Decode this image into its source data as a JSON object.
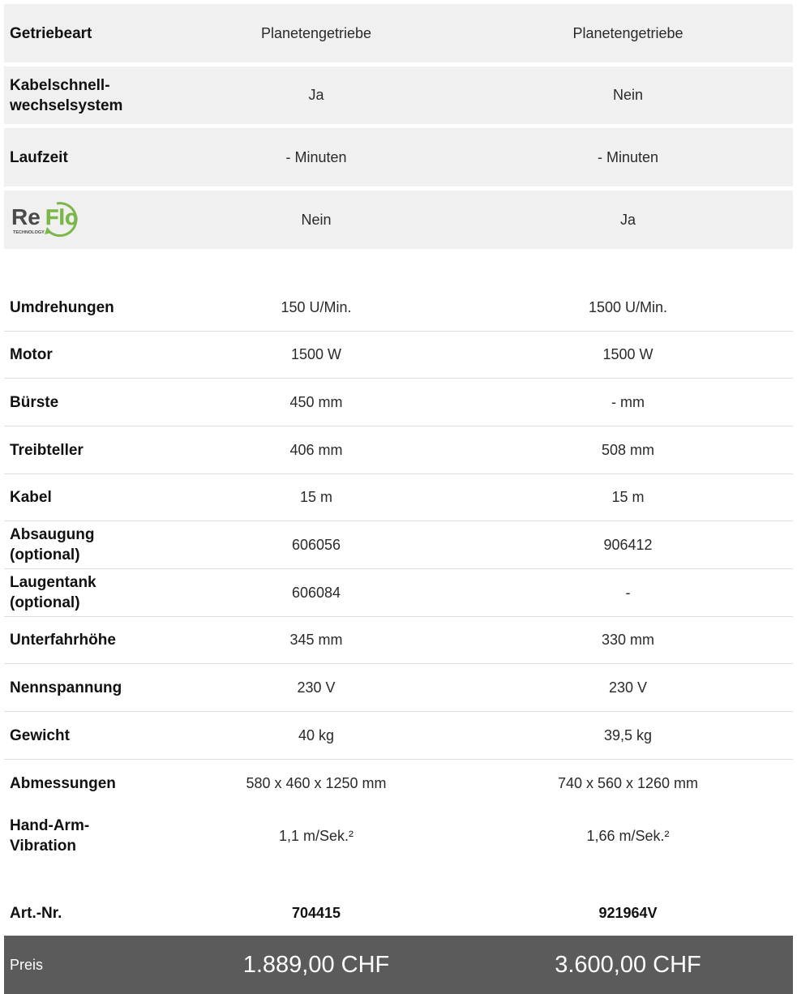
{
  "features": [
    {
      "label": "Getriebeart",
      "col1": "Planetengetriebe",
      "col2": "Planetengetriebe"
    },
    {
      "label": "Kabelschnell-\nwechselsystem",
      "col1": "Ja",
      "col2": "Nein"
    },
    {
      "label": "Laufzeit",
      "col1": "- Minuten",
      "col2": "- Minuten"
    }
  ],
  "reflo": {
    "logo_text_re": "Re",
    "logo_text_flo": "Flo",
    "logo_sub": "TECHNOLOGY",
    "col1": "Nein",
    "col2": "Ja",
    "colors": {
      "dark": "#4a4a4a",
      "green": "#7ab648"
    }
  },
  "specs": [
    {
      "label": "Umdrehungen",
      "col1": "150 U/Min.",
      "col2": "1500 U/Min."
    },
    {
      "label": "Motor",
      "col1": "1500 W",
      "col2": "1500 W"
    },
    {
      "label": "Bürste",
      "col1": "450 mm",
      "col2": "- mm"
    },
    {
      "label": "Treibteller",
      "col1": "406 mm",
      "col2": "508 mm"
    },
    {
      "label": "Kabel",
      "col1": "15 m",
      "col2": "15 m"
    },
    {
      "label": "Absaugung\n(optional)",
      "col1": "606056",
      "col2": "906412"
    },
    {
      "label": "Laugentank\n(optional)",
      "col1": "606084",
      "col2": "-"
    },
    {
      "label": "Unterfahrhöhe",
      "col1": "345 mm",
      "col2": "330 mm"
    },
    {
      "label": "Nennspannung",
      "col1": "230 V",
      "col2": "230 V"
    },
    {
      "label": "Gewicht",
      "col1": "40 kg",
      "col2": "39,5 kg"
    },
    {
      "label": "Abmessungen",
      "col1": "580 x 460 x 1250 mm",
      "col2": "740 x 560 x 1260 mm"
    },
    {
      "label": "Hand-Arm-\nVibration",
      "col1": "1,1 m/Sek.²",
      "col2": "1,66 m/Sek.²"
    }
  ],
  "article": {
    "label": "Art.-Nr.",
    "col1": "704415",
    "col2": "921964V"
  },
  "price": {
    "label": "Preis",
    "col1": "1.889,00 CHF",
    "col2": "3.600,00 CHF"
  }
}
